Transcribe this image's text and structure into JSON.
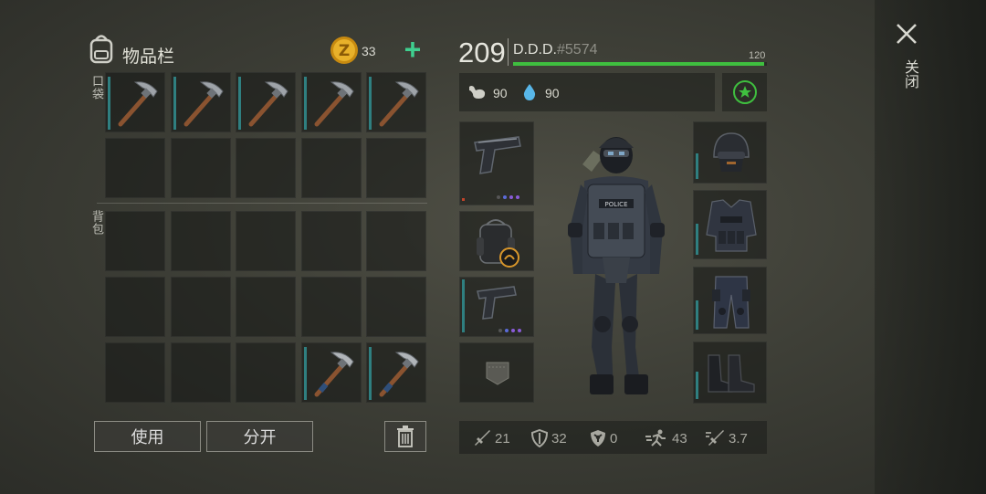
{
  "inventory": {
    "title": "物品栏",
    "coins": "33",
    "add_label": "+",
    "pocket_label": "口袋",
    "backpack_label": "背包"
  },
  "buttons": {
    "use": "使用",
    "split": "分开"
  },
  "player": {
    "level": "209",
    "name": "D.D.D.",
    "tag": "#5574",
    "xp_max": "120",
    "xp_fraction": 0.99,
    "food": "90",
    "water": "90"
  },
  "stats": {
    "attack": "21",
    "defense": "32",
    "radiation": "0",
    "speed": "43",
    "attack_speed": "3.7"
  },
  "side": {
    "close_label": "关闭"
  },
  "colors": {
    "accent_green": "#3fbf3f",
    "slot_bar": "#2f7f80",
    "coin": "#e0a514"
  }
}
